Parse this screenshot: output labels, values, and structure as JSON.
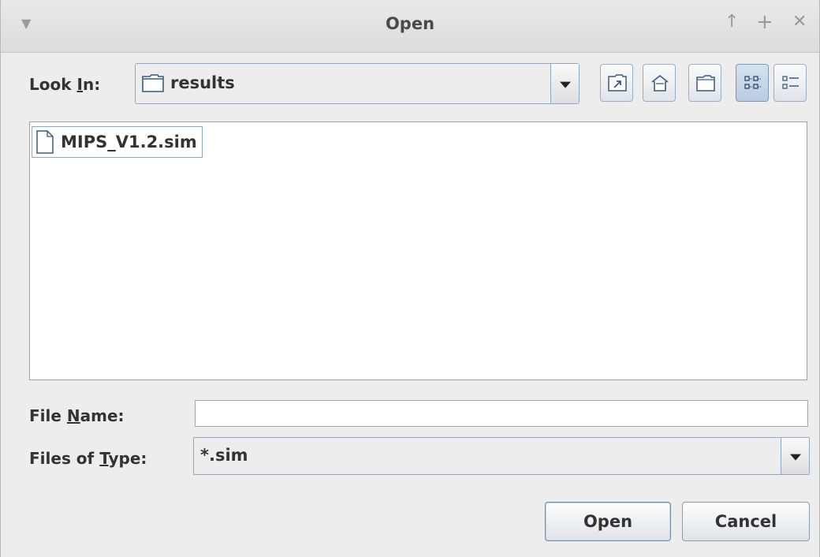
{
  "window": {
    "title": "Open"
  },
  "look_in": {
    "label_prefix": "Look ",
    "label_mnemonic": "I",
    "label_suffix": "n:",
    "value": "results"
  },
  "toolbar": {
    "up_folder_icon": "up-one-level-icon",
    "home_icon": "home-icon",
    "new_folder_icon": "new-folder-icon",
    "list_view_icon": "list-view-icon",
    "details_view_icon": "details-view-icon"
  },
  "files": [
    {
      "name": "MIPS_V1.2.sim",
      "icon": "file-icon"
    }
  ],
  "file_name": {
    "label_prefix": "File ",
    "label_mnemonic": "N",
    "label_suffix": "ame:",
    "value": ""
  },
  "file_type": {
    "label_prefix": "Files of ",
    "label_mnemonic": "T",
    "label_suffix": "ype:",
    "value": "*.sim"
  },
  "buttons": {
    "open_label": "Open",
    "cancel_label": "Cancel"
  },
  "colors": {
    "accent_border": "#8fa7c2",
    "selected_view": "#b9cbe0"
  }
}
